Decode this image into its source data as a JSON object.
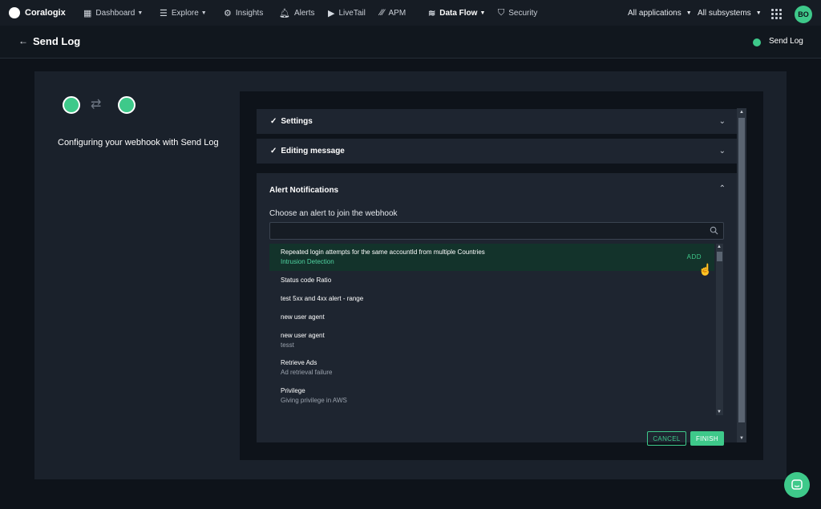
{
  "nav": {
    "brand": "Coralogix",
    "items": [
      {
        "label": "Dashboard",
        "icon": "dashboard-icon",
        "caret": true
      },
      {
        "label": "Explore",
        "icon": "explore-icon",
        "caret": true
      },
      {
        "label": "Insights",
        "icon": "insights-icon",
        "caret": false
      },
      {
        "label": "Alerts",
        "icon": "bell-icon",
        "caret": false
      },
      {
        "label": "LiveTail",
        "icon": "play-icon",
        "caret": false
      },
      {
        "label": "APM",
        "icon": "apm-icon",
        "caret": false
      },
      {
        "label": "Data Flow",
        "icon": "dataflow-icon",
        "caret": true
      },
      {
        "label": "Security",
        "icon": "shield-icon",
        "caret": false
      }
    ],
    "applications": "All applications",
    "subsystems": "All subsystems",
    "avatar": "BO"
  },
  "header": {
    "title": "Send Log",
    "status": "Send Log"
  },
  "left": {
    "config_text": "Configuring your webhook with Send Log"
  },
  "sections": {
    "settings": "Settings",
    "editing": "Editing message",
    "alerts": "Alert Notifications"
  },
  "alerts": {
    "choose_label": "Choose an alert to join the webhook",
    "search_placeholder": "",
    "add_label": "ADD",
    "items": [
      {
        "title": "Repeated login attempts for the same accountId from multiple Countries",
        "subtitle": "Intrusion Detection"
      },
      {
        "title": "Status code Ratio",
        "subtitle": ""
      },
      {
        "title": "test 5xx and 4xx alert - range",
        "subtitle": ""
      },
      {
        "title": "new user agent",
        "subtitle": ""
      },
      {
        "title": "new user agent",
        "subtitle": "tesst"
      },
      {
        "title": "Retrieve Ads",
        "subtitle": "Ad retrieval failure"
      },
      {
        "title": "Privilege",
        "subtitle": "Giving privilege in AWS"
      }
    ],
    "cancel_label": "CANCEL",
    "finish_label": "FINISH"
  },
  "colors": {
    "accent": "#3ec98a",
    "highlight_row": "#13332b"
  }
}
